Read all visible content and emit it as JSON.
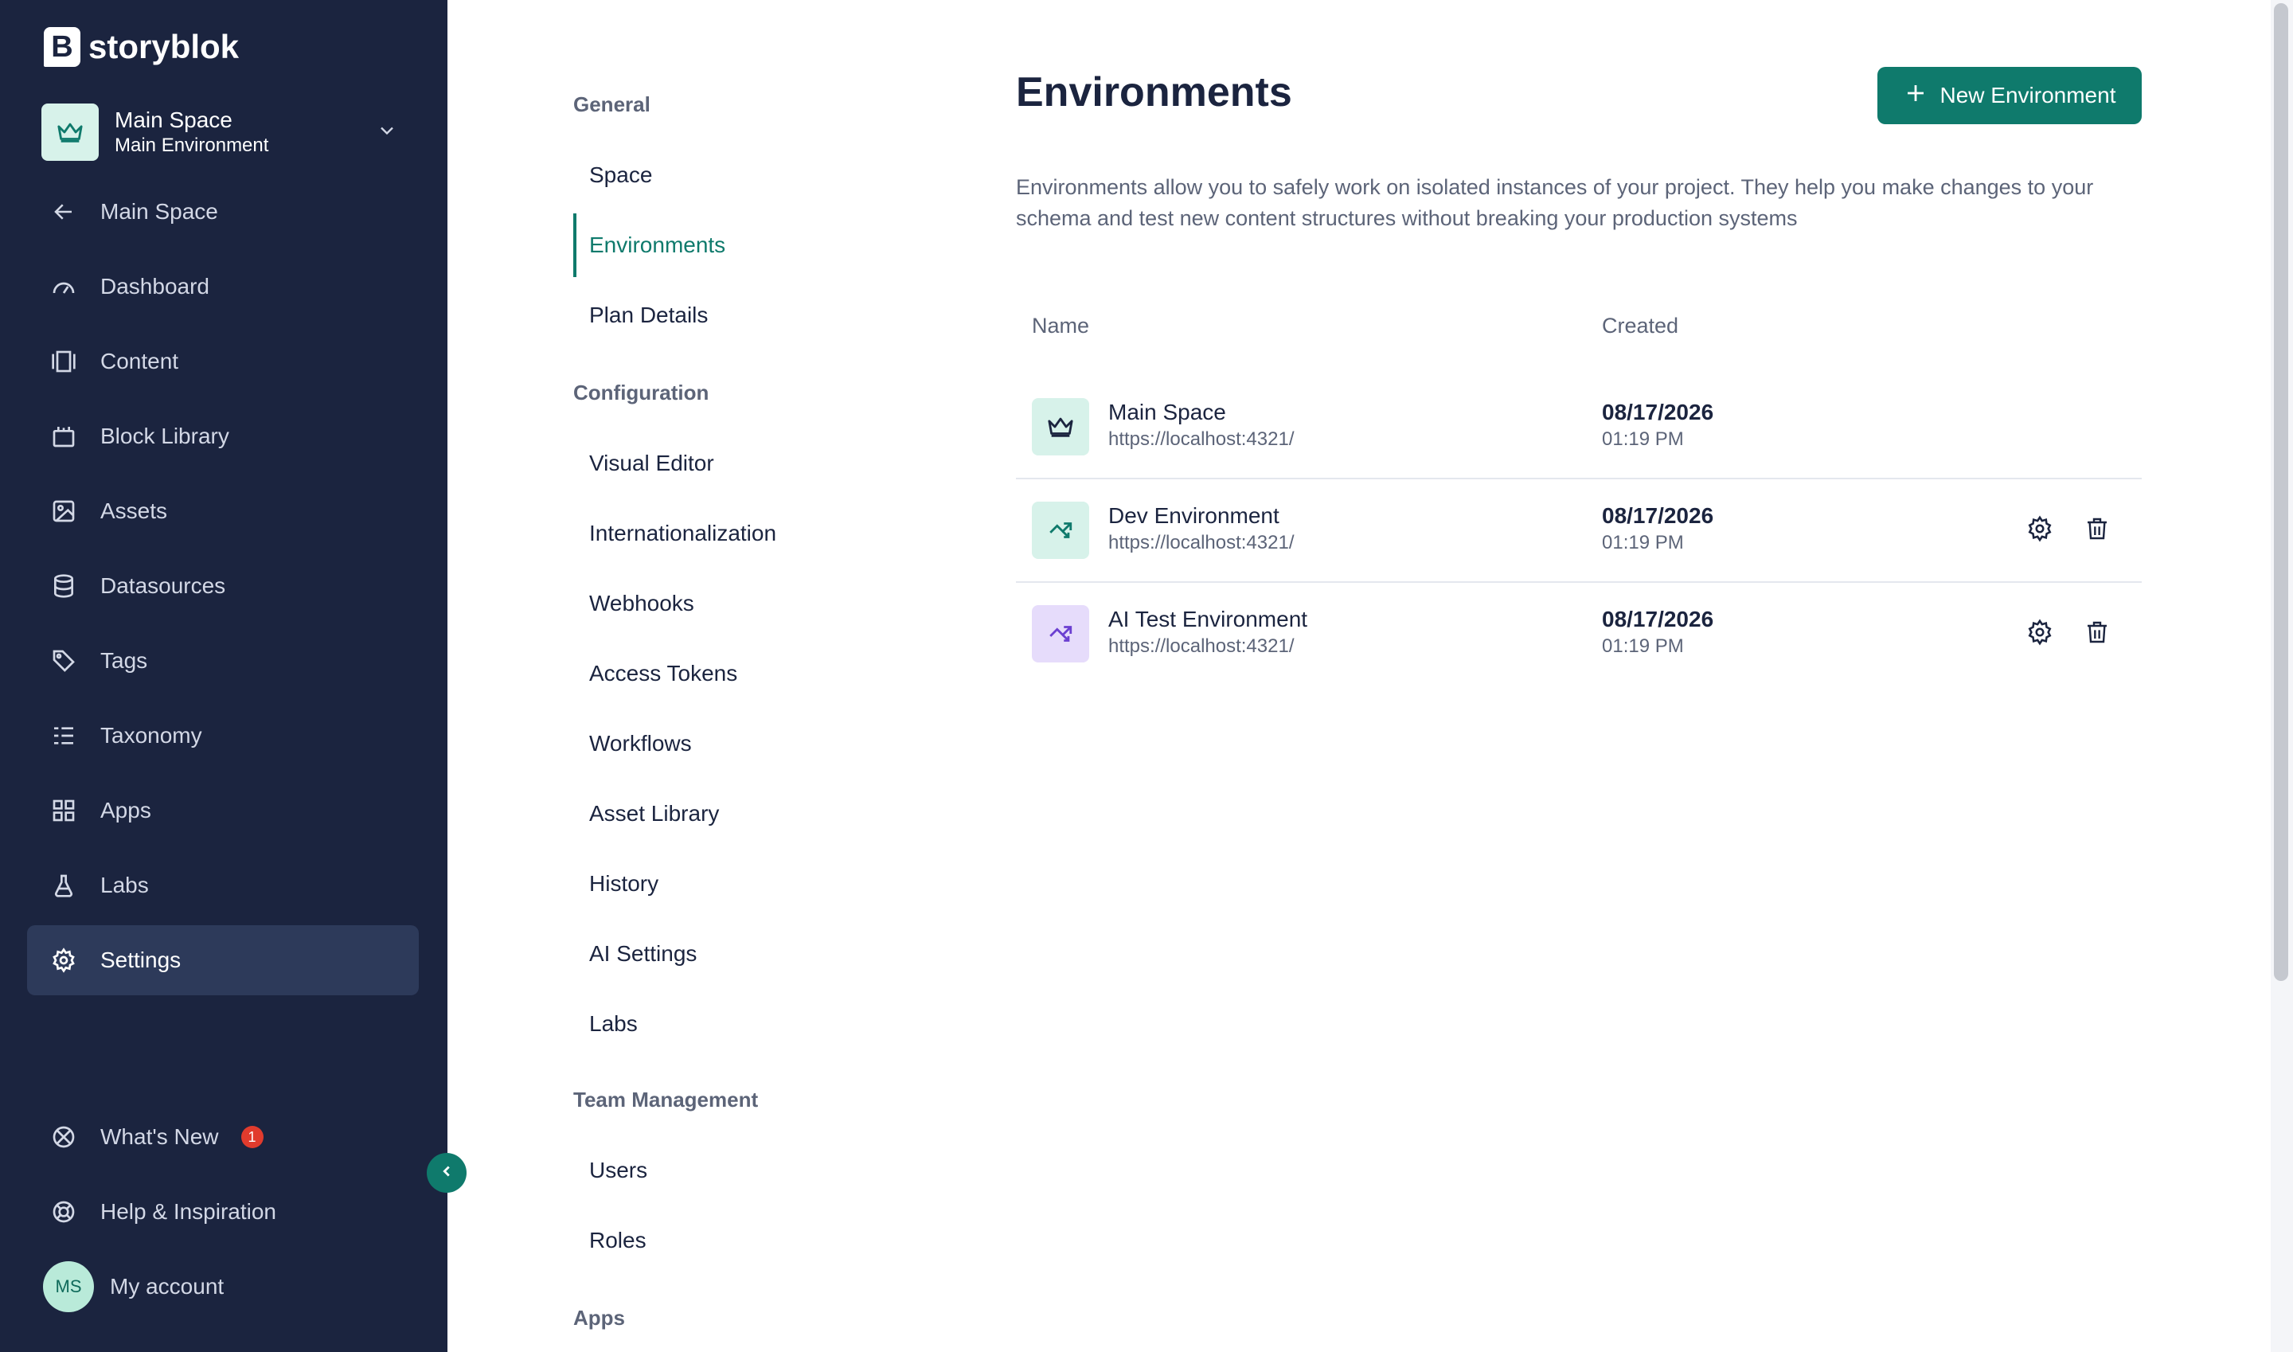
{
  "brand": {
    "logo_letter": "B",
    "name": "storyblok"
  },
  "space_switcher": {
    "space_name": "Main Space",
    "environment": "Main Environment"
  },
  "sidebar": {
    "back_label": "Main Space",
    "items": [
      {
        "label": "Dashboard",
        "icon": "dashboard-icon"
      },
      {
        "label": "Content",
        "icon": "content-icon"
      },
      {
        "label": "Block Library",
        "icon": "block-library-icon"
      },
      {
        "label": "Assets",
        "icon": "image-icon"
      },
      {
        "label": "Datasources",
        "icon": "database-icon"
      },
      {
        "label": "Tags",
        "icon": "tag-icon"
      },
      {
        "label": "Taxonomy",
        "icon": "list-icon"
      },
      {
        "label": "Apps",
        "icon": "apps-grid-icon"
      },
      {
        "label": "Labs",
        "icon": "flask-icon"
      },
      {
        "label": "Settings",
        "icon": "gear-icon",
        "active": true
      }
    ],
    "whats_new": {
      "label": "What's New",
      "badge": "1"
    },
    "help_label": "Help & Inspiration",
    "account": {
      "initials": "MS",
      "label": "My account"
    }
  },
  "subnav": {
    "sections": [
      {
        "heading": "General",
        "items": [
          "Space",
          "Environments",
          "Plan Details"
        ]
      },
      {
        "heading": "Configuration",
        "items": [
          "Visual Editor",
          "Internationalization",
          "Webhooks",
          "Access Tokens",
          "Workflows",
          "Asset Library",
          "History",
          "AI Settings",
          "Labs"
        ]
      },
      {
        "heading": "Team Management",
        "items": [
          "Users",
          "Roles"
        ]
      },
      {
        "heading": "Apps",
        "items": []
      }
    ],
    "active_item": "Environments"
  },
  "main": {
    "title": "Environments",
    "new_button_label": "New Environment",
    "description": "Environments allow you to safely work on isolated instances of your project. They help you make changes to your schema and test new content structures without breaking your production systems",
    "table": {
      "columns": [
        "Name",
        "Created"
      ],
      "rows": [
        {
          "name": "Main Space",
          "url": "https://localhost:4321/",
          "date": "08/17/2026",
          "time": "01:19 PM",
          "icon": "crown-icon",
          "icon_bg": "#d7f2ea",
          "icon_color": "#1b243f",
          "actions": false
        },
        {
          "name": "Dev Environment",
          "url": "https://localhost:4321/",
          "date": "08/17/2026",
          "time": "01:19 PM",
          "icon": "branch-icon",
          "icon_bg": "#d7f2ea",
          "icon_color": "#0f7a6c",
          "actions": true
        },
        {
          "name": "AI Test Environment",
          "url": "https://localhost:4321/",
          "date": "08/17/2026",
          "time": "01:19 PM",
          "icon": "branch-icon",
          "icon_bg": "#e6dcfb",
          "icon_color": "#6b3fd1",
          "actions": true
        }
      ]
    }
  },
  "colors": {
    "sidebar_bg": "#1b243f",
    "accent": "#0f7a6c",
    "badge": "#e13b2d"
  }
}
